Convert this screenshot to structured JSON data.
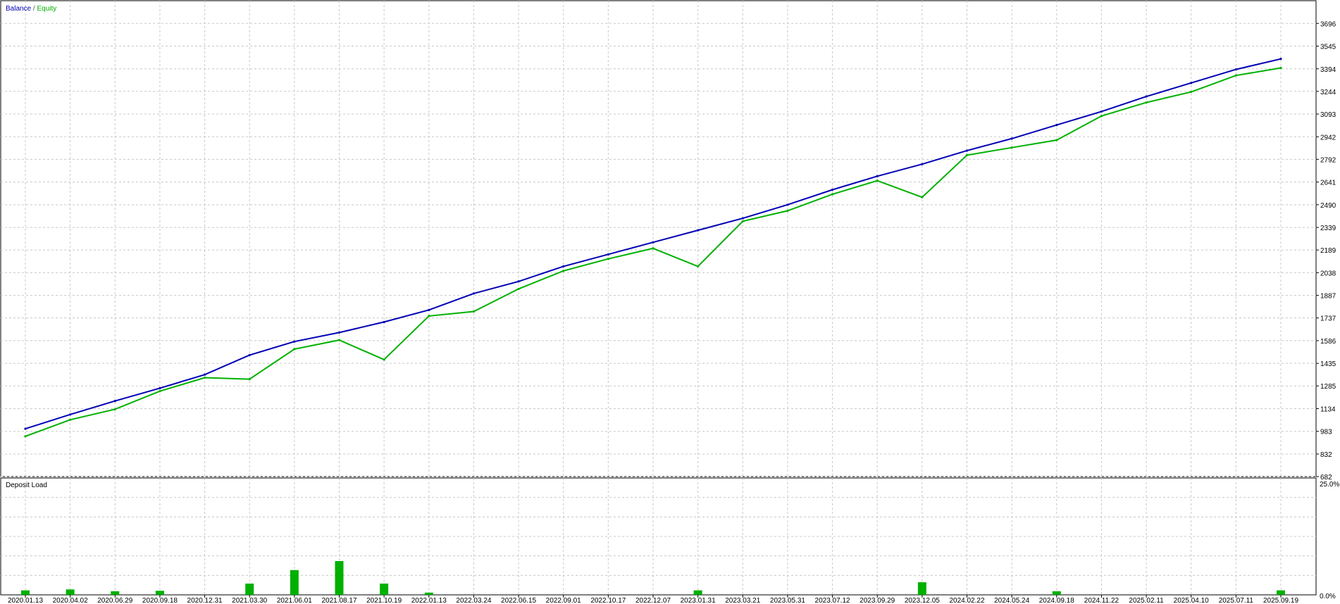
{
  "legend": {
    "balance": "Balance",
    "separator": " / ",
    "equity": "Equity"
  },
  "subpanel_title": "Deposit Load",
  "colors": {
    "balance": "#0000b4",
    "equity": "#00b000",
    "load": "#00b000",
    "grid": "#c8c8c8",
    "frame": "#000000"
  },
  "chart_data": [
    {
      "type": "line",
      "title": "",
      "series": [
        {
          "name": "Balance",
          "x": [
            "2020.01.13",
            "2020.04.02",
            "2020.06.29",
            "2020.09.18",
            "2020.12.31",
            "2021.03.30",
            "2021.06.01",
            "2021.08.17",
            "2021.10.19",
            "2022.01.13",
            "2022.03.24",
            "2022.06.15",
            "2022.09.01",
            "2022.10.17",
            "2022.12.07",
            "2023.01.31",
            "2023.03.21",
            "2023.05.31",
            "2023.07.12",
            "2023.09.29",
            "2023.12.05",
            "2024.02.22",
            "2024.05.24",
            "2024.09.18",
            "2024.11.22",
            "2025.02.11",
            "2025.04.10",
            "2025.07.11",
            "2025.09.19"
          ],
          "values": [
            1000,
            1095,
            1185,
            1270,
            1360,
            1490,
            1580,
            1640,
            1710,
            1790,
            1900,
            1980,
            2080,
            2160,
            2240,
            2320,
            2400,
            2490,
            2590,
            2680,
            2760,
            2850,
            2930,
            3020,
            3110,
            3210,
            3300,
            3390,
            3460
          ]
        },
        {
          "name": "Equity",
          "x": [
            "2020.01.13",
            "2020.04.02",
            "2020.06.29",
            "2020.09.18",
            "2020.12.31",
            "2021.03.30",
            "2021.06.01",
            "2021.08.17",
            "2021.10.19",
            "2022.01.13",
            "2022.03.24",
            "2022.06.15",
            "2022.09.01",
            "2022.10.17",
            "2022.12.07",
            "2023.01.31",
            "2023.03.21",
            "2023.05.31",
            "2023.07.12",
            "2023.09.29",
            "2023.12.05",
            "2024.02.22",
            "2024.05.24",
            "2024.09.18",
            "2024.11.22",
            "2025.02.11",
            "2025.04.10",
            "2025.07.11",
            "2025.09.19"
          ],
          "values": [
            950,
            1060,
            1130,
            1250,
            1340,
            1330,
            1530,
            1590,
            1460,
            1750,
            1780,
            1930,
            2050,
            2130,
            2200,
            2080,
            2380,
            2450,
            2560,
            2650,
            2540,
            2820,
            2870,
            2920,
            3080,
            3170,
            3240,
            3350,
            3400
          ]
        }
      ],
      "y_ticks": [
        682,
        832,
        983,
        1134,
        1285,
        1435,
        1586,
        1737,
        1887,
        2038,
        2189,
        2339,
        2490,
        2641,
        2792,
        2942,
        3093,
        3244,
        3394,
        3545,
        3696
      ],
      "x_ticks": [
        "2020.01.13",
        "2020.04.02",
        "2020.06.29",
        "2020.09.18",
        "2020.12.31",
        "2021.03.30",
        "2021.06.01",
        "2021.08.17",
        "2021.10.19",
        "2022.01.13",
        "2022.03.24",
        "2022.06.15",
        "2022.09.01",
        "2022.10.17",
        "2022.12.07",
        "2023.01.31",
        "2023.03.21",
        "2023.05.31",
        "2023.07.12",
        "2023.09.29",
        "2023.12.05",
        "2024.02.22",
        "2024.05.24",
        "2024.09.18",
        "2024.11.22",
        "2025.02.11",
        "2025.04.10",
        "2025.07.11",
        "2025.09.19"
      ],
      "ylim": [
        682,
        3847
      ],
      "grid": true,
      "legend_position": "top-left"
    },
    {
      "type": "bar",
      "title": "Deposit Load",
      "y_ticks": [
        "25.0%",
        "0.0%"
      ],
      "ylim": [
        0,
        25
      ],
      "peaks": [
        {
          "x": "2020.01.13",
          "value": 1.0
        },
        {
          "x": "2020.04.02",
          "value": 1.2
        },
        {
          "x": "2020.06.29",
          "value": 0.8
        },
        {
          "x": "2020.09.18",
          "value": 0.9
        },
        {
          "x": "2021.03.30",
          "value": 2.5
        },
        {
          "x": "2021.06.01",
          "value": 5.5
        },
        {
          "x": "2021.08.17",
          "value": 7.5
        },
        {
          "x": "2021.10.19",
          "value": 2.5
        },
        {
          "x": "2022.01.13",
          "value": 0.5
        },
        {
          "x": "2023.01.31",
          "value": 1.0
        },
        {
          "x": "2023.12.05",
          "value": 2.8
        },
        {
          "x": "2024.09.18",
          "value": 0.8
        },
        {
          "x": "2025.09.19",
          "value": 1.0
        }
      ]
    }
  ]
}
